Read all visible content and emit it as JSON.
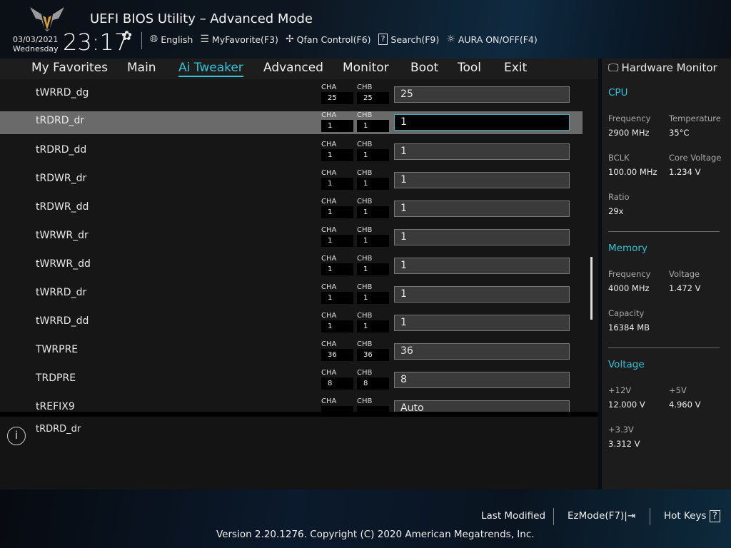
{
  "header": {
    "title": "UEFI BIOS Utility – Advanced Mode",
    "date": "03/03/2021",
    "day": "Wednesday",
    "time": "23:17",
    "tools": [
      {
        "icon": "globe-icon",
        "label": "English"
      },
      {
        "icon": "favorite-list-icon",
        "label": "MyFavorite(F3)"
      },
      {
        "icon": "fan-icon",
        "label": "Qfan Control(F6)"
      },
      {
        "icon": "search-help-icon",
        "label": "Search(F9)"
      },
      {
        "icon": "aura-light-icon",
        "label": "AURA ON/OFF(F4)"
      }
    ]
  },
  "nav": [
    "My Favorites",
    "Main",
    "Ai Tweaker",
    "Advanced",
    "Monitor",
    "Boot",
    "Tool",
    "Exit"
  ],
  "active_tab": "Ai Tweaker",
  "ch_labels": {
    "a": "CHA",
    "b": "CHB"
  },
  "rows": [
    {
      "label": "tWRRD_dg",
      "cha": "25",
      "chb": "25",
      "value": "25"
    },
    {
      "label": "tRDRD_dr",
      "cha": "1",
      "chb": "1",
      "value": "1"
    },
    {
      "label": "tRDRD_dd",
      "cha": "1",
      "chb": "1",
      "value": "1"
    },
    {
      "label": "tRDWR_dr",
      "cha": "1",
      "chb": "1",
      "value": "1"
    },
    {
      "label": "tRDWR_dd",
      "cha": "1",
      "chb": "1",
      "value": "1"
    },
    {
      "label": "tWRWR_dr",
      "cha": "1",
      "chb": "1",
      "value": "1"
    },
    {
      "label": "tWRWR_dd",
      "cha": "1",
      "chb": "1",
      "value": "1"
    },
    {
      "label": "tWRRD_dr",
      "cha": "1",
      "chb": "1",
      "value": "1"
    },
    {
      "label": "tWRRD_dd",
      "cha": "1",
      "chb": "1",
      "value": "1"
    },
    {
      "label": "TWRPRE",
      "cha": "36",
      "chb": "36",
      "value": "36"
    },
    {
      "label": "TRDPRE",
      "cha": "8",
      "chb": "8",
      "value": "8"
    },
    {
      "label": "tREFIX9",
      "cha": "",
      "chb": "",
      "value": "Auto"
    }
  ],
  "info": {
    "text": "tRDRD_dr"
  },
  "hw": {
    "title": "Hardware Monitor",
    "cpu": {
      "title": "CPU",
      "freq_k": "Frequency",
      "freq": "2900 MHz",
      "temp_k": "Temperature",
      "temp": "35°C",
      "bclk_k": "BCLK",
      "bclk": "100.00 MHz",
      "cv_k": "Core Voltage",
      "cv": "1.234 V",
      "ratio_k": "Ratio",
      "ratio": "29x"
    },
    "mem": {
      "title": "Memory",
      "freq_k": "Frequency",
      "freq": "4000 MHz",
      "volt_k": "Voltage",
      "volt": "1.472 V",
      "cap_k": "Capacity",
      "cap": "16384 MB"
    },
    "volt": {
      "title": "Voltage",
      "v12_k": "+12V",
      "v12": "12.000 V",
      "v5_k": "+5V",
      "v5": "4.960 V",
      "v33_k": "+3.3V",
      "v33": "3.312 V"
    }
  },
  "footer": {
    "last_modified": "Last Modified",
    "ezmode": "EzMode(F7)|",
    "hotkeys": "Hot Keys",
    "hotkeys_icon": "?",
    "copyright": "Version 2.20.1276. Copyright (C) 2020 American Megatrends, Inc."
  }
}
